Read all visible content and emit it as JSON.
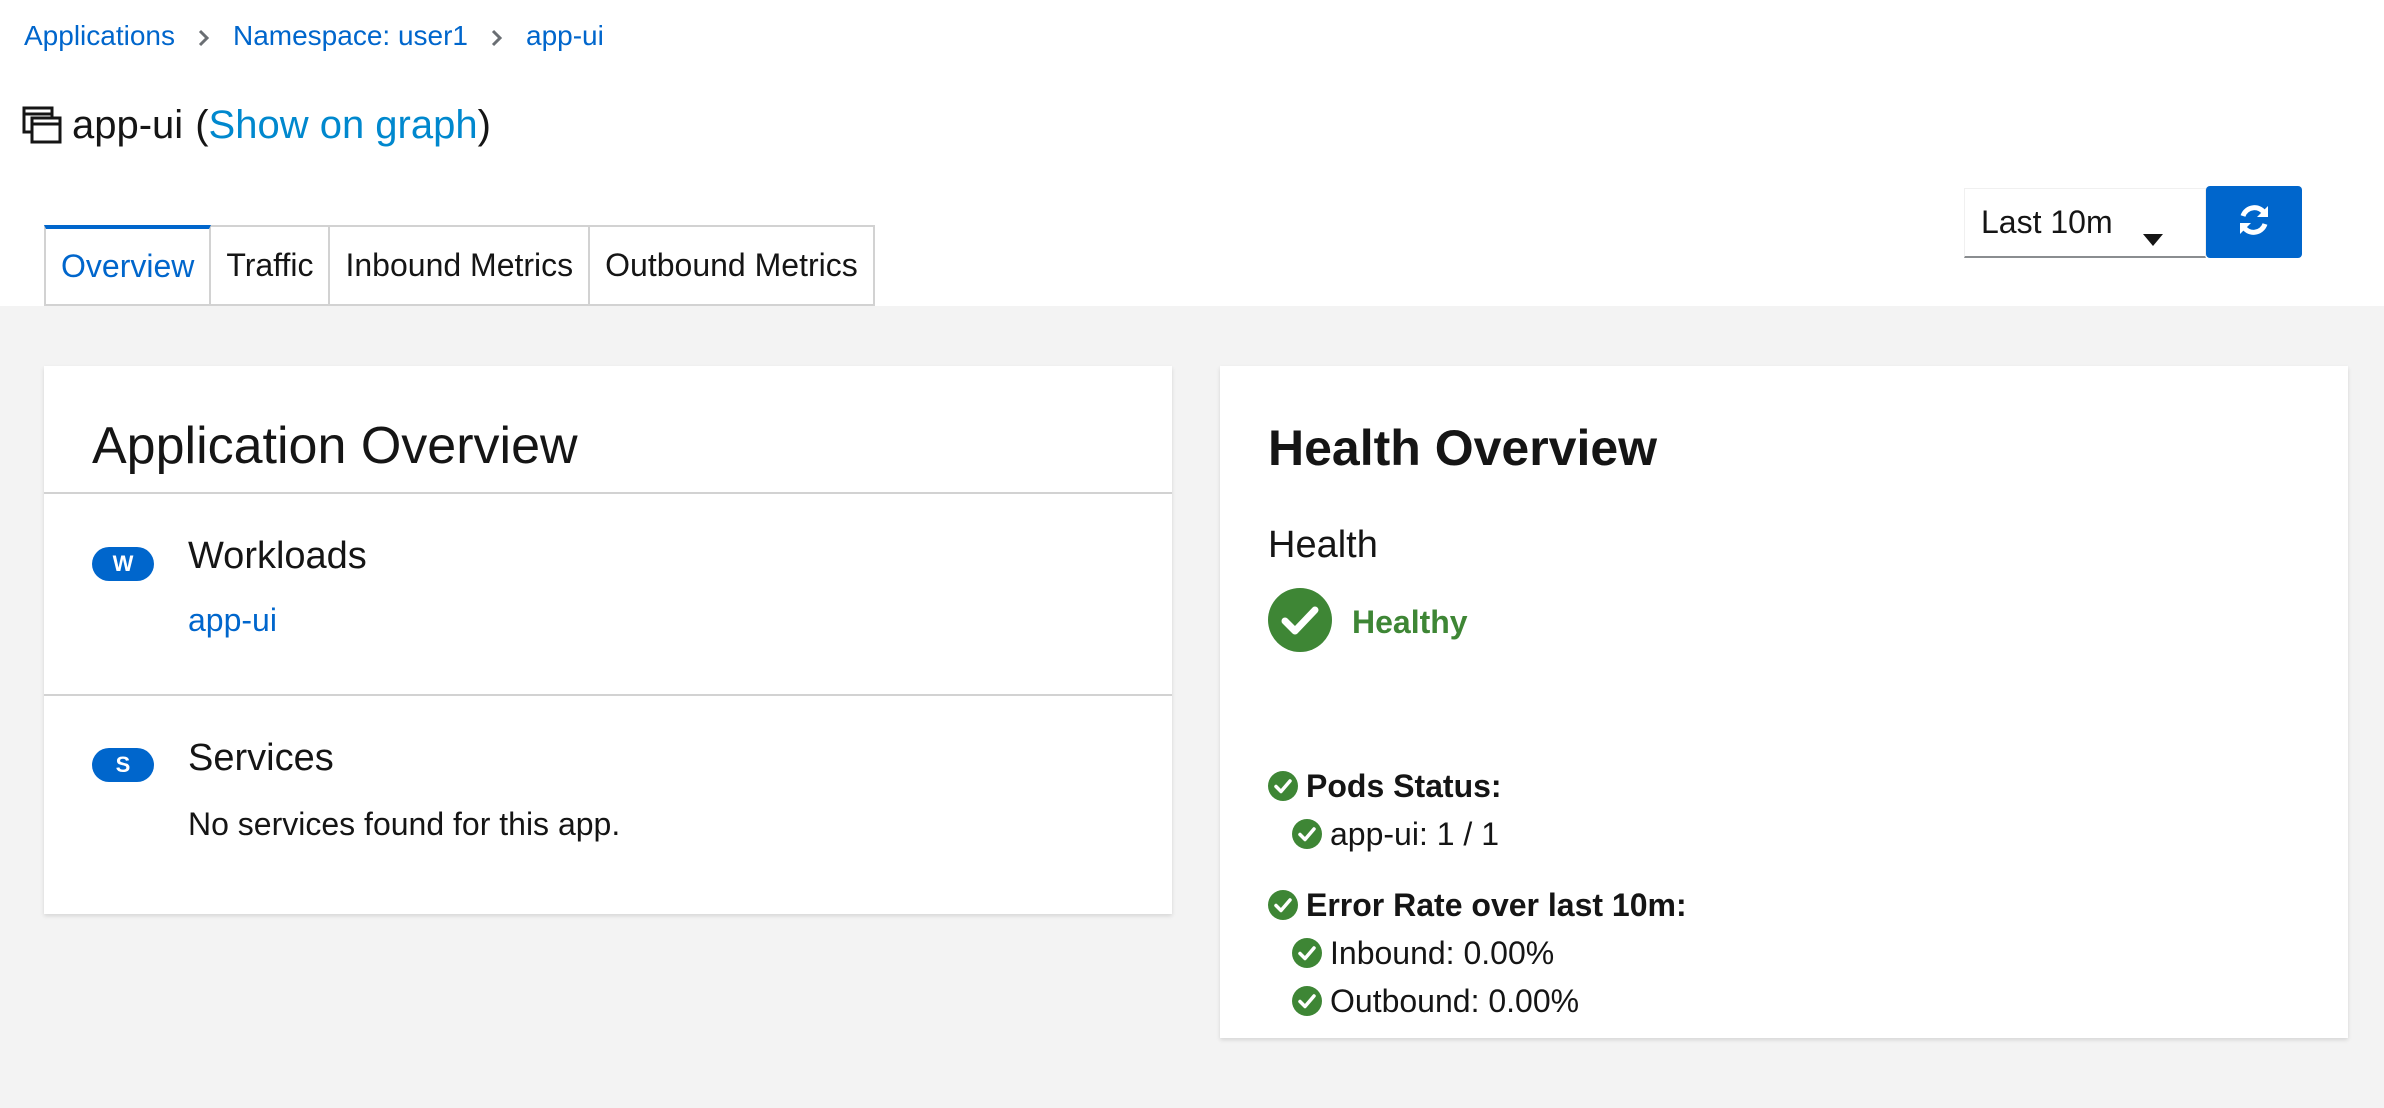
{
  "breadcrumb": {
    "applications": "Applications",
    "namespace": "Namespace: user1",
    "current": "app-ui"
  },
  "title": {
    "name": "app-ui",
    "open_paren": "(",
    "show_on_graph": "Show on graph",
    "close_paren": ")"
  },
  "tabs": [
    {
      "label": "Overview",
      "active": true
    },
    {
      "label": "Traffic"
    },
    {
      "label": "Inbound Metrics"
    },
    {
      "label": "Outbound Metrics"
    }
  ],
  "time_range": {
    "selected": "Last 10m"
  },
  "icons": {
    "app": "application-window-icon",
    "refresh": "refresh-icon",
    "caret": "caret-down-icon",
    "check": "check-circle-icon",
    "separator": "chevron-right-icon"
  },
  "colors": {
    "link": "#0066cc",
    "healthy": "#3e8635",
    "badge": "#0066cc"
  },
  "app_overview": {
    "title": "Application Overview",
    "workloads": {
      "badge": "W",
      "title": "Workloads",
      "items": [
        "app-ui"
      ]
    },
    "services": {
      "badge": "S",
      "title": "Services",
      "empty_text": "No services found for this app."
    }
  },
  "health_overview": {
    "title": "Health Overview",
    "health_label": "Health",
    "status": "Healthy",
    "pods_status_label": "Pods Status:",
    "pods": [
      "app-ui: 1 / 1"
    ],
    "error_rate_label": "Error Rate over last 10m:",
    "inbound": "Inbound: 0.00%",
    "outbound": "Outbound: 0.00%"
  }
}
